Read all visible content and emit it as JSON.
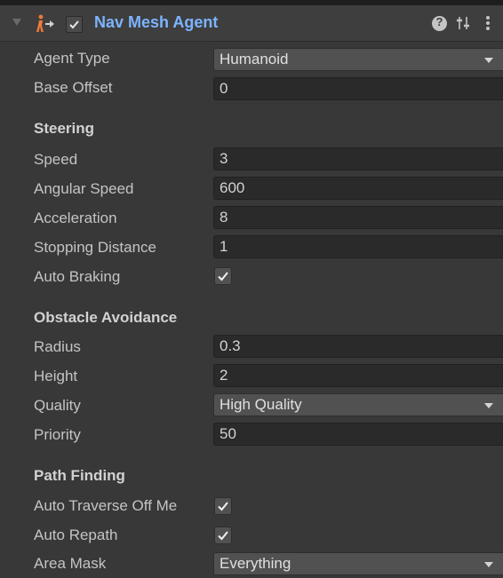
{
  "component": {
    "title": "Nav Mesh Agent",
    "enabled": true,
    "icons": [
      "foldout-arrow-icon",
      "nav-mesh-agent-icon",
      "help-icon",
      "presets-icon",
      "context-menu-icon"
    ]
  },
  "fields": {
    "agent_type": {
      "label": "Agent Type",
      "value": "Humanoid"
    },
    "base_offset": {
      "label": "Base Offset",
      "value": "0"
    }
  },
  "steering": {
    "header": "Steering",
    "speed": {
      "label": "Speed",
      "value": "3"
    },
    "angular_speed": {
      "label": "Angular Speed",
      "value": "600"
    },
    "acceleration": {
      "label": "Acceleration",
      "value": "8"
    },
    "stopping_distance": {
      "label": "Stopping Distance",
      "value": "1"
    },
    "auto_braking": {
      "label": "Auto Braking",
      "checked": true
    }
  },
  "obstacle_avoidance": {
    "header": "Obstacle Avoidance",
    "radius": {
      "label": "Radius",
      "value": "0.3"
    },
    "height": {
      "label": "Height",
      "value": "2"
    },
    "quality": {
      "label": "Quality",
      "value": "High Quality"
    },
    "priority": {
      "label": "Priority",
      "value": "50"
    }
  },
  "path_finding": {
    "header": "Path Finding",
    "auto_traverse": {
      "label": "Auto Traverse Off Me",
      "checked": true
    },
    "auto_repath": {
      "label": "Auto Repath",
      "checked": true
    },
    "area_mask": {
      "label": "Area Mask",
      "value": "Everything"
    }
  },
  "colors": {
    "background": "#383838",
    "header": "#3e3e3e",
    "title": "#7cb4ff",
    "field": "#2a2a2a",
    "dropdown": "#515151",
    "icon_orange": "#f07a3a"
  }
}
